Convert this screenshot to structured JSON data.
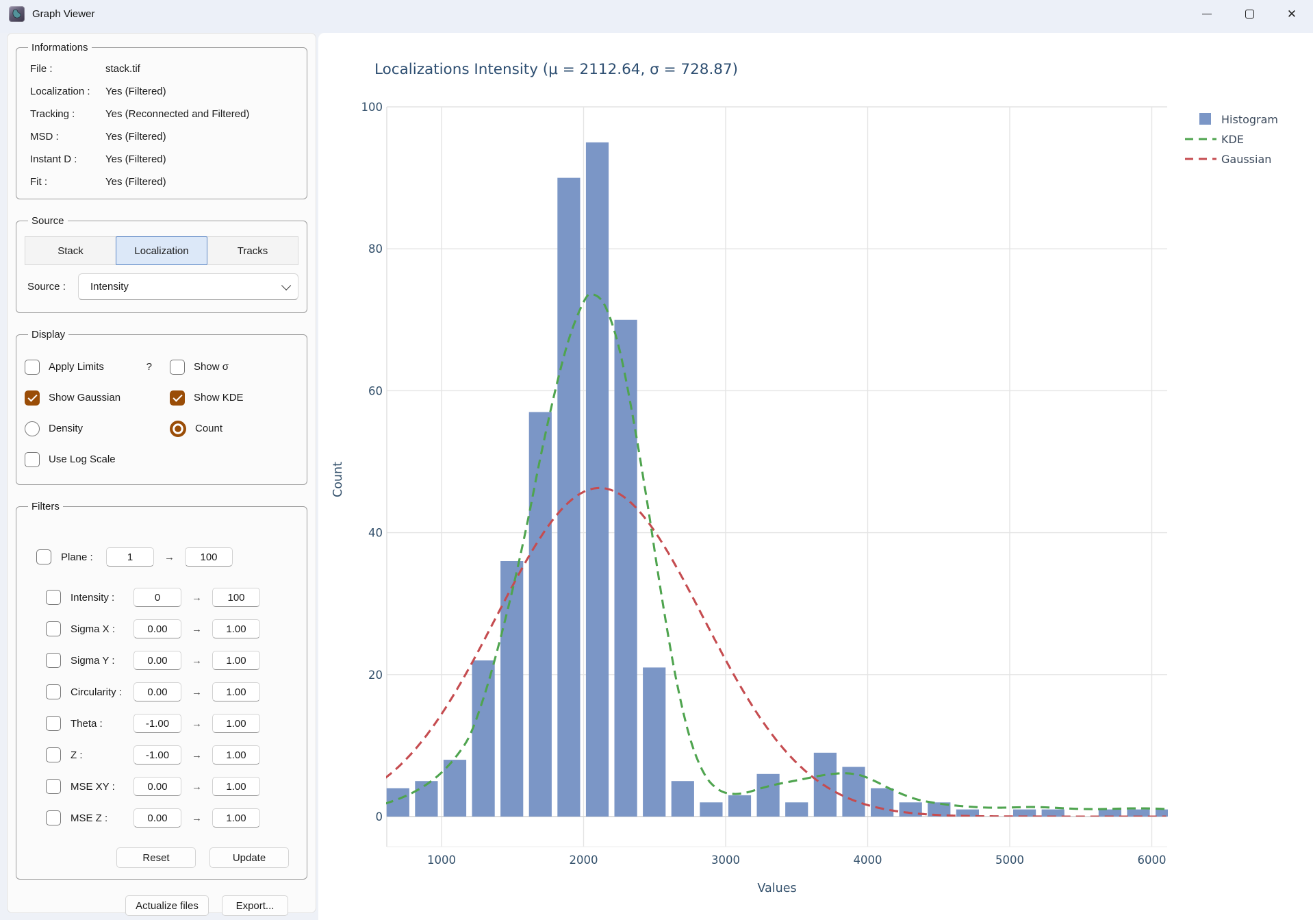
{
  "window": {
    "title": "Graph Viewer"
  },
  "panel": {
    "informations": {
      "legend": "Informations",
      "rows": [
        {
          "label": "File :",
          "value": "stack.tif"
        },
        {
          "label": "Localization :",
          "value": "Yes (Filtered)"
        },
        {
          "label": "Tracking :",
          "value": "Yes (Reconnected and Filtered)"
        },
        {
          "label": "MSD :",
          "value": "Yes (Filtered)"
        },
        {
          "label": "Instant D :",
          "value": "Yes (Filtered)"
        },
        {
          "label": "Fit :",
          "value": "Yes (Filtered)"
        }
      ]
    },
    "source": {
      "legend": "Source",
      "tabs": [
        {
          "label": "Stack",
          "active": false
        },
        {
          "label": "Localization",
          "active": true
        },
        {
          "label": "Tracks",
          "active": false
        }
      ],
      "source_label": "Source :",
      "selected": "Intensity"
    },
    "display": {
      "legend": "Display",
      "help": "?",
      "options": [
        {
          "label": "Apply Limits",
          "type": "checkbox",
          "checked": false
        },
        {
          "label": "Show σ",
          "type": "checkbox",
          "checked": false
        },
        {
          "label": "Show Gaussian",
          "type": "checkbox",
          "checked": true
        },
        {
          "label": "Show KDE",
          "type": "checkbox",
          "checked": true
        },
        {
          "label": "Density",
          "type": "radio",
          "checked": false
        },
        {
          "label": "Count",
          "type": "radio",
          "checked": true
        },
        {
          "label": "Use Log Scale",
          "type": "checkbox",
          "checked": false
        }
      ]
    },
    "filters": {
      "legend": "Filters",
      "arrow": "→",
      "rows": [
        {
          "label": "Plane :",
          "from": "1",
          "to": "100",
          "checked": false,
          "plane": true
        },
        {
          "label": "Intensity :",
          "from": "0",
          "to": "100",
          "checked": false
        },
        {
          "label": "Sigma X :",
          "from": "0.00",
          "to": "1.00",
          "checked": false
        },
        {
          "label": "Sigma Y :",
          "from": "0.00",
          "to": "1.00",
          "checked": false
        },
        {
          "label": "Circularity :",
          "from": "0.00",
          "to": "1.00",
          "checked": false
        },
        {
          "label": "Theta :",
          "from": "-1.00",
          "to": "1.00",
          "checked": false
        },
        {
          "label": "Z :",
          "from": "-1.00",
          "to": "1.00",
          "checked": false
        },
        {
          "label": "MSE XY :",
          "from": "0.00",
          "to": "1.00",
          "checked": false
        },
        {
          "label": "MSE Z :",
          "from": "0.00",
          "to": "1.00",
          "checked": false
        }
      ],
      "reset_label": "Reset",
      "update_label": "Update"
    },
    "actions": {
      "actualize_label": "Actualize files",
      "export_label": "Export..."
    }
  },
  "chart_data": {
    "type": "bar",
    "title": "Localizations Intensity (μ = 2112.64, σ = 728.87)",
    "xlabel": "Values",
    "ylabel": "Count",
    "xlim": [
      615,
      6110
    ],
    "ylim": [
      0,
      100
    ],
    "xticks": [
      1000,
      2000,
      3000,
      4000,
      5000,
      6000
    ],
    "yticks": [
      0,
      20,
      40,
      60,
      80,
      100
    ],
    "grid": true,
    "legend_position": "upper right outside",
    "bins": {
      "first_center": 693,
      "step": 200.5
    },
    "values": [
      4,
      5,
      8,
      22,
      36,
      57,
      90,
      95,
      70,
      21,
      5,
      2,
      3,
      6,
      2,
      9,
      7,
      4,
      2,
      2,
      1,
      0,
      1,
      1,
      0,
      1,
      1,
      1
    ],
    "kde_points": [
      [
        600,
        1.8
      ],
      [
        700,
        2.5
      ],
      [
        800,
        3.4
      ],
      [
        900,
        4.6
      ],
      [
        1000,
        6.2
      ],
      [
        1100,
        8.4
      ],
      [
        1200,
        11.5
      ],
      [
        1300,
        17
      ],
      [
        1400,
        24
      ],
      [
        1500,
        32
      ],
      [
        1600,
        41
      ],
      [
        1700,
        51
      ],
      [
        1800,
        60
      ],
      [
        1900,
        67.5
      ],
      [
        2000,
        72.5
      ],
      [
        2060,
        73.6
      ],
      [
        2150,
        72
      ],
      [
        2250,
        66
      ],
      [
        2350,
        56
      ],
      [
        2450,
        44
      ],
      [
        2550,
        31
      ],
      [
        2650,
        19.5
      ],
      [
        2750,
        11
      ],
      [
        2850,
        6
      ],
      [
        2950,
        3.8
      ],
      [
        3050,
        3.2
      ],
      [
        3150,
        3.4
      ],
      [
        3250,
        4
      ],
      [
        3350,
        4.5
      ],
      [
        3450,
        4.9
      ],
      [
        3550,
        5.3
      ],
      [
        3650,
        5.7
      ],
      [
        3750,
        6
      ],
      [
        3850,
        6.1
      ],
      [
        3950,
        5.8
      ],
      [
        4050,
        5
      ],
      [
        4150,
        4
      ],
      [
        4250,
        3.1
      ],
      [
        4350,
        2.4
      ],
      [
        4450,
        2
      ],
      [
        4550,
        1.7
      ],
      [
        4650,
        1.5
      ],
      [
        4750,
        1.35
      ],
      [
        4850,
        1.25
      ],
      [
        4950,
        1.25
      ],
      [
        5050,
        1.3
      ],
      [
        5150,
        1.35
      ],
      [
        5250,
        1.3
      ],
      [
        5350,
        1.2
      ],
      [
        5450,
        1.1
      ],
      [
        5550,
        1.05
      ],
      [
        5650,
        1.05
      ],
      [
        5750,
        1.1
      ],
      [
        5850,
        1.15
      ],
      [
        5950,
        1.15
      ],
      [
        6050,
        1.1
      ],
      [
        6110,
        1.05
      ]
    ],
    "gaussian": {
      "mu": 2112.64,
      "sigma": 728.87,
      "peak": 46.3,
      "range": [
        600,
        6110
      ]
    },
    "legend": [
      {
        "label": "Histogram",
        "type": "square",
        "color": "#7b96c6"
      },
      {
        "label": "KDE",
        "type": "dashed",
        "color": "#4fa44f"
      },
      {
        "label": "Gaussian",
        "type": "dashed",
        "color": "#c54c50"
      }
    ],
    "colors": {
      "bar": "#7b96c6",
      "kde": "#4fa44f",
      "gaussian": "#c54c50",
      "tick_text": "#33506b",
      "title_text": "#2d4e71",
      "grid": "#e4e4e4",
      "zero_line": "#d2d2d2",
      "spine": "#d9d9d9",
      "legend_text": "#3c4a5c"
    }
  }
}
